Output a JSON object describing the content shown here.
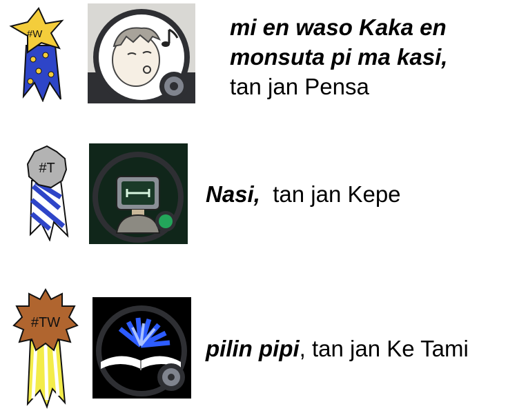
{
  "entries": [
    {
      "badge": "#W",
      "ribbon_colors": {
        "badge": "#f4cd3b",
        "ribbon": "#2e45c8",
        "dots": "#f4cd3b"
      },
      "avatar_icon": "whistling-person-icon",
      "status": "idle",
      "title_line1": "mi en waso Kaka en",
      "title_line2": "monsuta pi ma kasi,",
      "byline": "tan jan Pensa"
    },
    {
      "badge": "#T",
      "ribbon_colors": {
        "badge": "#b3b3b3",
        "ribbon": "#2e45c8"
      },
      "avatar_icon": "robot-icon",
      "status": "online",
      "title": "Nasi,",
      "byline": "tan jan Kepe"
    },
    {
      "badge": "#TW",
      "ribbon_colors": {
        "badge": "#b0652f",
        "ribbon": "#f3ec4a"
      },
      "avatar_icon": "open-book-icon",
      "status": "idle",
      "title": "pilin pipi",
      "byline": ", tan jan Ke Tami"
    }
  ],
  "status_colors": {
    "online": "#23a55a",
    "idle": "#80848e"
  }
}
